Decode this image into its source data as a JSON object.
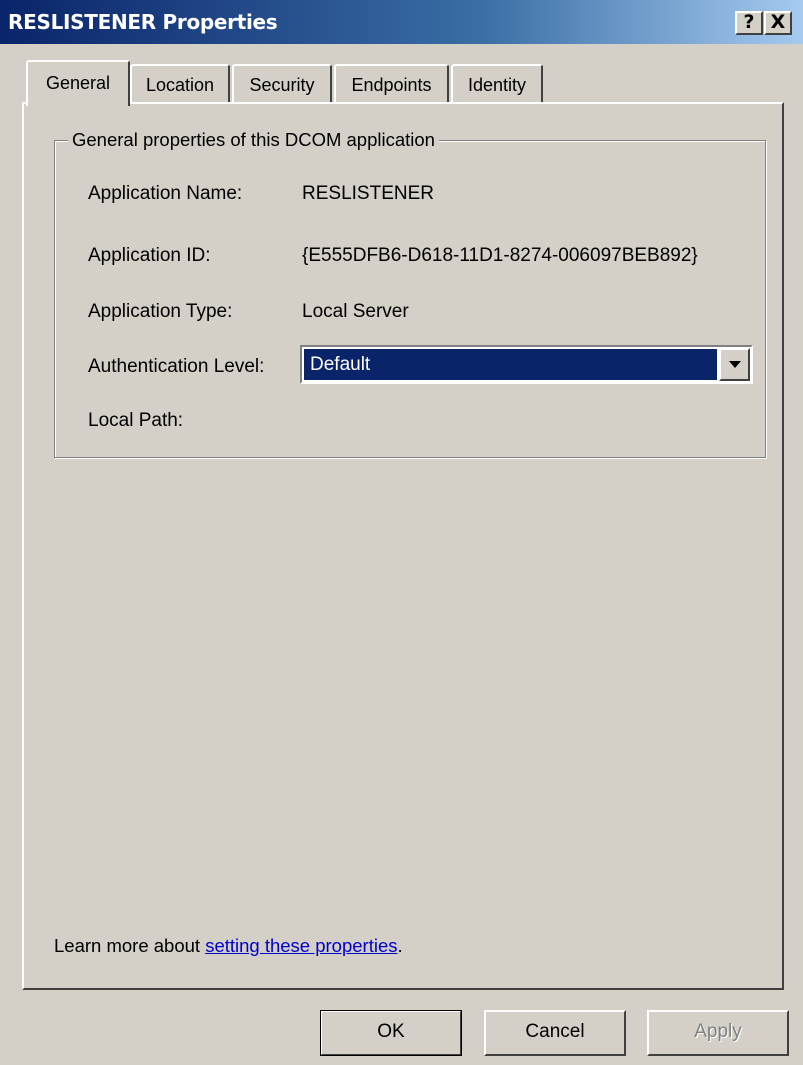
{
  "window": {
    "title": "RESLISTENER Properties"
  },
  "titlebar_buttons": {
    "help": "?",
    "close": "X"
  },
  "tabs": [
    {
      "label": "General",
      "active": true
    },
    {
      "label": "Location",
      "active": false
    },
    {
      "label": "Security",
      "active": false
    },
    {
      "label": "Endpoints",
      "active": false
    },
    {
      "label": "Identity",
      "active": false
    }
  ],
  "group": {
    "legend": "General properties of this DCOM application"
  },
  "fields": {
    "app_name": {
      "label": "Application Name:",
      "value": "RESLISTENER"
    },
    "app_id": {
      "label": "Application ID:",
      "value": "{E555DFB6-D618-11D1-8274-006097BEB892}"
    },
    "app_type": {
      "label": "Application Type:",
      "value": "Local Server"
    },
    "auth_level": {
      "label": "Authentication Level:",
      "value": "Default"
    },
    "local_path": {
      "label": "Local Path:",
      "value": ""
    }
  },
  "learn_more": {
    "prefix": "Learn more about ",
    "link": "setting these properties",
    "suffix": "."
  },
  "buttons": {
    "ok": "OK",
    "cancel": "Cancel",
    "apply": "Apply"
  }
}
